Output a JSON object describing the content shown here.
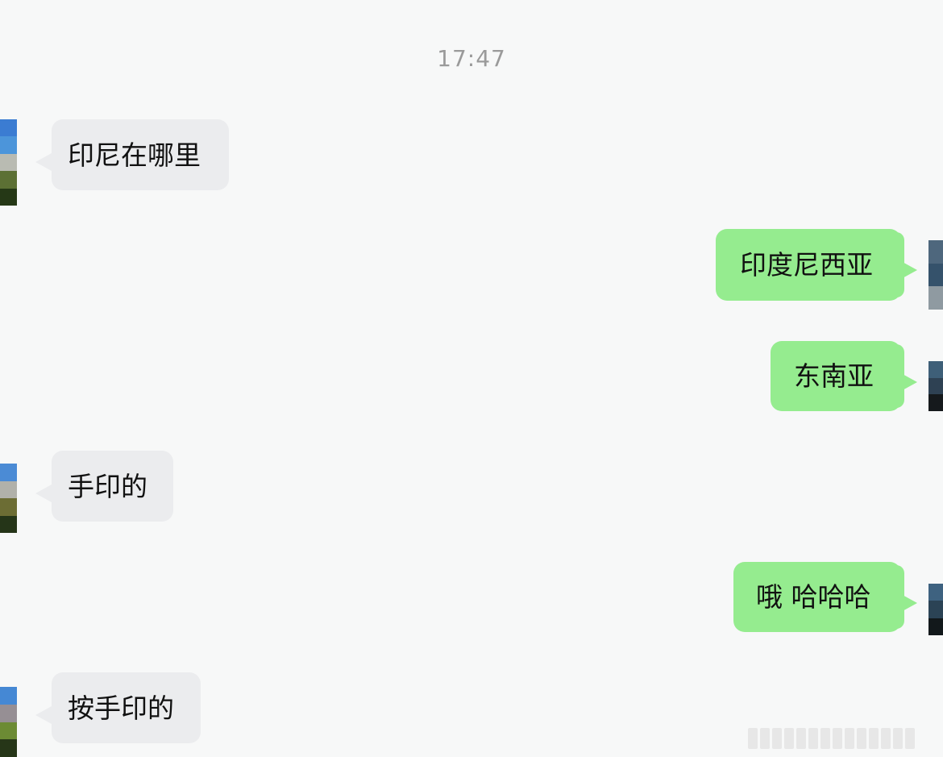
{
  "time": "17:47",
  "messages": [
    {
      "side": "left",
      "text": "印尼在哪里"
    },
    {
      "side": "right",
      "text": "印度尼西亚"
    },
    {
      "side": "right",
      "text": "东南亚"
    },
    {
      "side": "left",
      "text": "手印的"
    },
    {
      "side": "right",
      "text": "哦 哈哈哈"
    },
    {
      "side": "left",
      "text": "按手印的"
    }
  ],
  "colors": {
    "background": "#f7f8f8",
    "left_bubble": "#ebecee",
    "right_bubble": "#95ec8f",
    "timestamp": "#9a9a9a"
  }
}
